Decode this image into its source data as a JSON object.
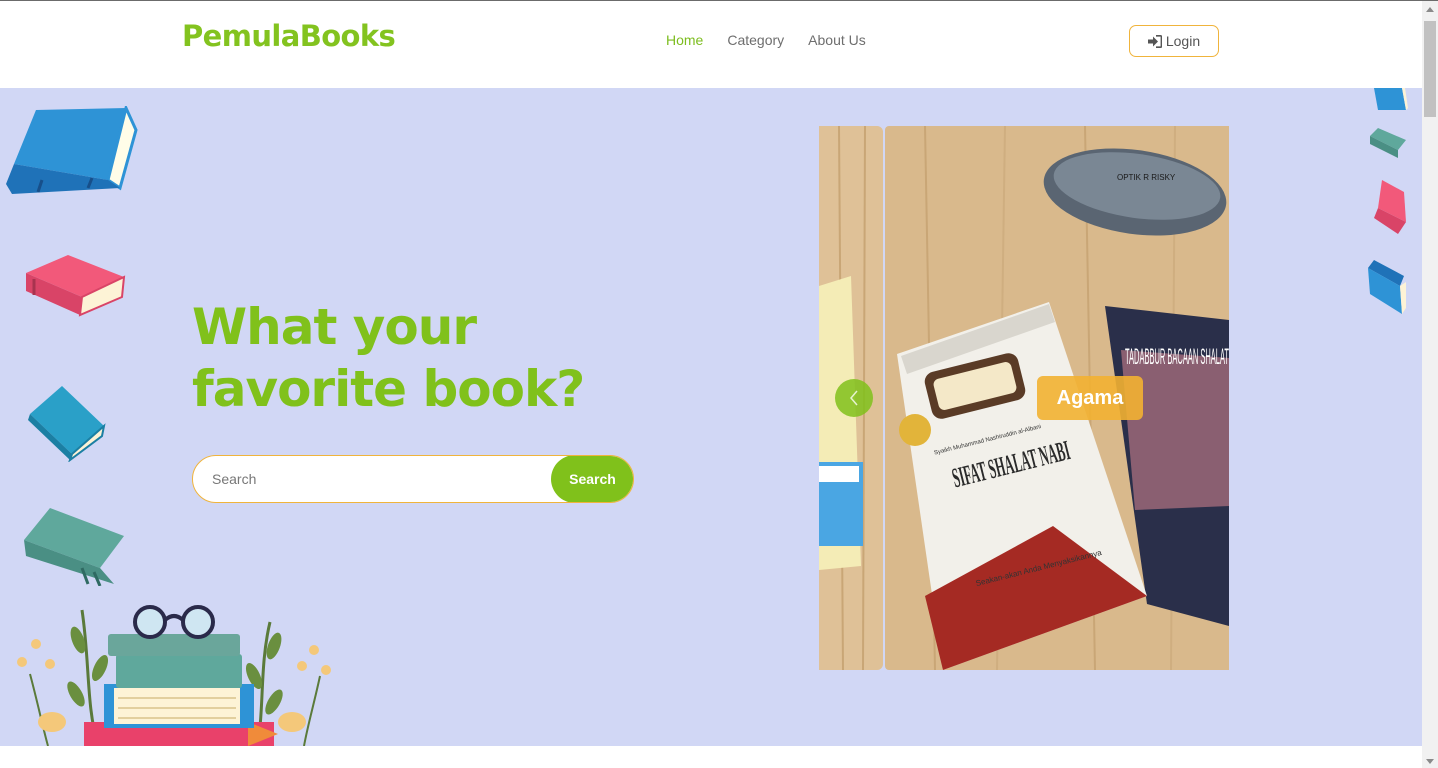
{
  "navbar": {
    "brand": "PemulaBooks",
    "links": [
      {
        "label": "Home",
        "active": true
      },
      {
        "label": "Category",
        "active": false
      },
      {
        "label": "About Us",
        "active": false
      }
    ],
    "login_label": "Login"
  },
  "hero": {
    "headline_line1": "What your",
    "headline_line2": "favorite book?",
    "search": {
      "placeholder": "Search",
      "value": "",
      "button_label": "Search"
    }
  },
  "carousel": {
    "active_category": "Agama",
    "slide_book_title": "SIFAT SHALAT NABI",
    "slide_book_author": "Syaikh Muhammad Nashiruddin al-Albani",
    "slide_book_subtitle": "Seakan-akan Anda Menyaksikannya",
    "side_book_title": "TADABBUR BACAAN SHALAT",
    "case_label": "OPTIK R RISKY"
  },
  "colors": {
    "brand_green": "#80c11b",
    "accent_orange": "#f0b43c",
    "hero_background": "#d1d7f5",
    "nav_text": "#6e6e6e"
  },
  "icons": {
    "login": "sign-in-icon",
    "carousel_prev": "chevron-left-icon"
  }
}
